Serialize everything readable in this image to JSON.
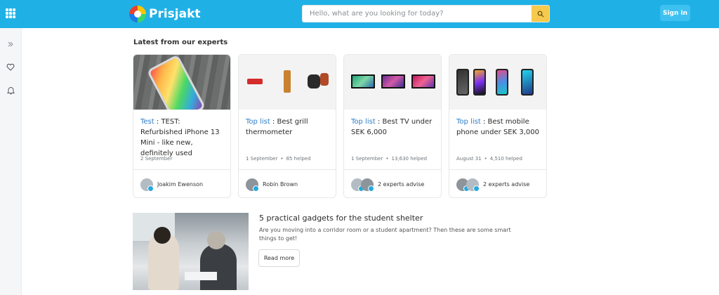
{
  "header": {
    "logo_text": "Prisjakt",
    "search_placeholder": "Hello, what are you looking for today?",
    "signin_label": "Sign in",
    "brand_color": "#1fb1e6"
  },
  "sidebar": {
    "icons": [
      "expand-icon",
      "heart-icon",
      "bell-icon"
    ]
  },
  "experts": {
    "title": "Latest from our experts",
    "cards": [
      {
        "kind": "Test",
        "sep": " : ",
        "title": "TEST: Refurbished iPhone 13 Mini - like new, definitely used",
        "date": "2 September",
        "helped": "",
        "author": "Joakim Ewenson"
      },
      {
        "kind": "Top list",
        "sep": " : ",
        "title": "Best grill thermometer",
        "date": "1 September",
        "helped": "85 helped",
        "author": "Robin Brown"
      },
      {
        "kind": "Top list",
        "sep": " : ",
        "title": "Best TV under SEK 6,000",
        "date": "1 September",
        "helped": "13,630 helped",
        "author": "2 experts advise"
      },
      {
        "kind": "Top list",
        "sep": " : ",
        "title": "Best mobile phone under SEK 3,000",
        "date": "August 31",
        "helped": "4,510 helped",
        "author": "2 experts advise"
      }
    ],
    "dot": "•"
  },
  "feature": {
    "title": "5 practical gadgets for the student shelter",
    "description": "Are you moving into a corridor room or a student apartment? Then these are some smart things to get!",
    "button_label": "Read more"
  }
}
